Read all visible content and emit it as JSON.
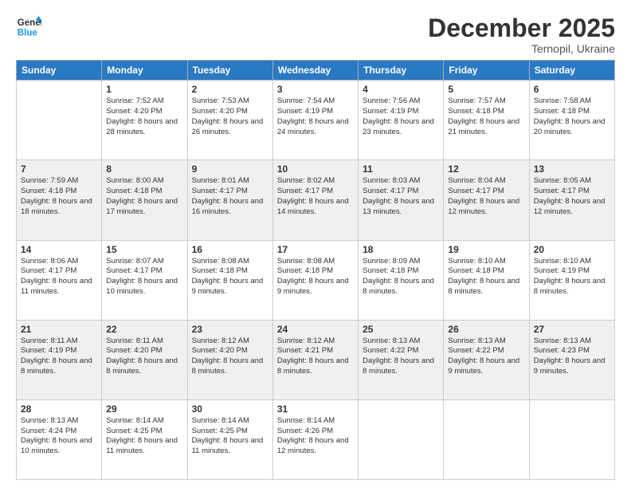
{
  "logo": {
    "line1": "General",
    "line2": "Blue"
  },
  "title": "December 2025",
  "subtitle": "Ternopil, Ukraine",
  "weekdays": [
    "Sunday",
    "Monday",
    "Tuesday",
    "Wednesday",
    "Thursday",
    "Friday",
    "Saturday"
  ],
  "weeks": [
    [
      {
        "day": "",
        "sunrise": "",
        "sunset": "",
        "daylight": ""
      },
      {
        "day": "1",
        "sunrise": "Sunrise: 7:52 AM",
        "sunset": "Sunset: 4:20 PM",
        "daylight": "Daylight: 8 hours and 28 minutes."
      },
      {
        "day": "2",
        "sunrise": "Sunrise: 7:53 AM",
        "sunset": "Sunset: 4:20 PM",
        "daylight": "Daylight: 8 hours and 26 minutes."
      },
      {
        "day": "3",
        "sunrise": "Sunrise: 7:54 AM",
        "sunset": "Sunset: 4:19 PM",
        "daylight": "Daylight: 8 hours and 24 minutes."
      },
      {
        "day": "4",
        "sunrise": "Sunrise: 7:56 AM",
        "sunset": "Sunset: 4:19 PM",
        "daylight": "Daylight: 8 hours and 23 minutes."
      },
      {
        "day": "5",
        "sunrise": "Sunrise: 7:57 AM",
        "sunset": "Sunset: 4:18 PM",
        "daylight": "Daylight: 8 hours and 21 minutes."
      },
      {
        "day": "6",
        "sunrise": "Sunrise: 7:58 AM",
        "sunset": "Sunset: 4:18 PM",
        "daylight": "Daylight: 8 hours and 20 minutes."
      }
    ],
    [
      {
        "day": "7",
        "sunrise": "Sunrise: 7:59 AM",
        "sunset": "Sunset: 4:18 PM",
        "daylight": "Daylight: 8 hours and 18 minutes."
      },
      {
        "day": "8",
        "sunrise": "Sunrise: 8:00 AM",
        "sunset": "Sunset: 4:18 PM",
        "daylight": "Daylight: 8 hours and 17 minutes."
      },
      {
        "day": "9",
        "sunrise": "Sunrise: 8:01 AM",
        "sunset": "Sunset: 4:17 PM",
        "daylight": "Daylight: 8 hours and 16 minutes."
      },
      {
        "day": "10",
        "sunrise": "Sunrise: 8:02 AM",
        "sunset": "Sunset: 4:17 PM",
        "daylight": "Daylight: 8 hours and 14 minutes."
      },
      {
        "day": "11",
        "sunrise": "Sunrise: 8:03 AM",
        "sunset": "Sunset: 4:17 PM",
        "daylight": "Daylight: 8 hours and 13 minutes."
      },
      {
        "day": "12",
        "sunrise": "Sunrise: 8:04 AM",
        "sunset": "Sunset: 4:17 PM",
        "daylight": "Daylight: 8 hours and 12 minutes."
      },
      {
        "day": "13",
        "sunrise": "Sunrise: 8:05 AM",
        "sunset": "Sunset: 4:17 PM",
        "daylight": "Daylight: 8 hours and 12 minutes."
      }
    ],
    [
      {
        "day": "14",
        "sunrise": "Sunrise: 8:06 AM",
        "sunset": "Sunset: 4:17 PM",
        "daylight": "Daylight: 8 hours and 11 minutes."
      },
      {
        "day": "15",
        "sunrise": "Sunrise: 8:07 AM",
        "sunset": "Sunset: 4:17 PM",
        "daylight": "Daylight: 8 hours and 10 minutes."
      },
      {
        "day": "16",
        "sunrise": "Sunrise: 8:08 AM",
        "sunset": "Sunset: 4:18 PM",
        "daylight": "Daylight: 8 hours and 9 minutes."
      },
      {
        "day": "17",
        "sunrise": "Sunrise: 8:08 AM",
        "sunset": "Sunset: 4:18 PM",
        "daylight": "Daylight: 8 hours and 9 minutes."
      },
      {
        "day": "18",
        "sunrise": "Sunrise: 8:09 AM",
        "sunset": "Sunset: 4:18 PM",
        "daylight": "Daylight: 8 hours and 8 minutes."
      },
      {
        "day": "19",
        "sunrise": "Sunrise: 8:10 AM",
        "sunset": "Sunset: 4:18 PM",
        "daylight": "Daylight: 8 hours and 8 minutes."
      },
      {
        "day": "20",
        "sunrise": "Sunrise: 8:10 AM",
        "sunset": "Sunset: 4:19 PM",
        "daylight": "Daylight: 8 hours and 8 minutes."
      }
    ],
    [
      {
        "day": "21",
        "sunrise": "Sunrise: 8:11 AM",
        "sunset": "Sunset: 4:19 PM",
        "daylight": "Daylight: 8 hours and 8 minutes."
      },
      {
        "day": "22",
        "sunrise": "Sunrise: 8:11 AM",
        "sunset": "Sunset: 4:20 PM",
        "daylight": "Daylight: 8 hours and 8 minutes."
      },
      {
        "day": "23",
        "sunrise": "Sunrise: 8:12 AM",
        "sunset": "Sunset: 4:20 PM",
        "daylight": "Daylight: 8 hours and 8 minutes."
      },
      {
        "day": "24",
        "sunrise": "Sunrise: 8:12 AM",
        "sunset": "Sunset: 4:21 PM",
        "daylight": "Daylight: 8 hours and 8 minutes."
      },
      {
        "day": "25",
        "sunrise": "Sunrise: 8:13 AM",
        "sunset": "Sunset: 4:22 PM",
        "daylight": "Daylight: 8 hours and 8 minutes."
      },
      {
        "day": "26",
        "sunrise": "Sunrise: 8:13 AM",
        "sunset": "Sunset: 4:22 PM",
        "daylight": "Daylight: 8 hours and 9 minutes."
      },
      {
        "day": "27",
        "sunrise": "Sunrise: 8:13 AM",
        "sunset": "Sunset: 4:23 PM",
        "daylight": "Daylight: 8 hours and 9 minutes."
      }
    ],
    [
      {
        "day": "28",
        "sunrise": "Sunrise: 8:13 AM",
        "sunset": "Sunset: 4:24 PM",
        "daylight": "Daylight: 8 hours and 10 minutes."
      },
      {
        "day": "29",
        "sunrise": "Sunrise: 8:14 AM",
        "sunset": "Sunset: 4:25 PM",
        "daylight": "Daylight: 8 hours and 11 minutes."
      },
      {
        "day": "30",
        "sunrise": "Sunrise: 8:14 AM",
        "sunset": "Sunset: 4:25 PM",
        "daylight": "Daylight: 8 hours and 11 minutes."
      },
      {
        "day": "31",
        "sunrise": "Sunrise: 8:14 AM",
        "sunset": "Sunset: 4:26 PM",
        "daylight": "Daylight: 8 hours and 12 minutes."
      },
      {
        "day": "",
        "sunrise": "",
        "sunset": "",
        "daylight": ""
      },
      {
        "day": "",
        "sunrise": "",
        "sunset": "",
        "daylight": ""
      },
      {
        "day": "",
        "sunrise": "",
        "sunset": "",
        "daylight": ""
      }
    ]
  ]
}
